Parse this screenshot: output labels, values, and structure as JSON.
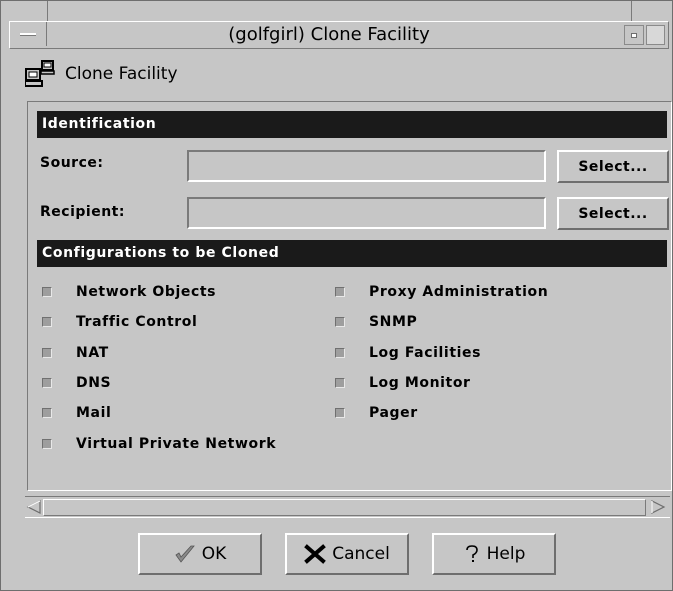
{
  "window": {
    "title": "(golfgirl) Clone Facility"
  },
  "header": {
    "icon": "computer-icon",
    "label": "Clone Facility"
  },
  "identification": {
    "heading": "Identification",
    "source_label": "Source:",
    "source_value": "",
    "recipient_label": "Recipient:",
    "recipient_value": "",
    "select_label": "Select..."
  },
  "configurations": {
    "heading": "Configurations to be Cloned",
    "left": [
      "Network Objects",
      "Traffic Control",
      "NAT",
      "DNS",
      "Mail",
      "Virtual Private Network"
    ],
    "right": [
      "Proxy Administration",
      "SNMP",
      "Log Facilities",
      "Log Monitor",
      "Pager"
    ]
  },
  "buttons": {
    "ok": "OK",
    "cancel": "Cancel",
    "help": "Help"
  },
  "colors": {
    "background": "#c6c6c6",
    "section_bar": "#1a1a1a",
    "ok_check": "#8a8a8a"
  }
}
